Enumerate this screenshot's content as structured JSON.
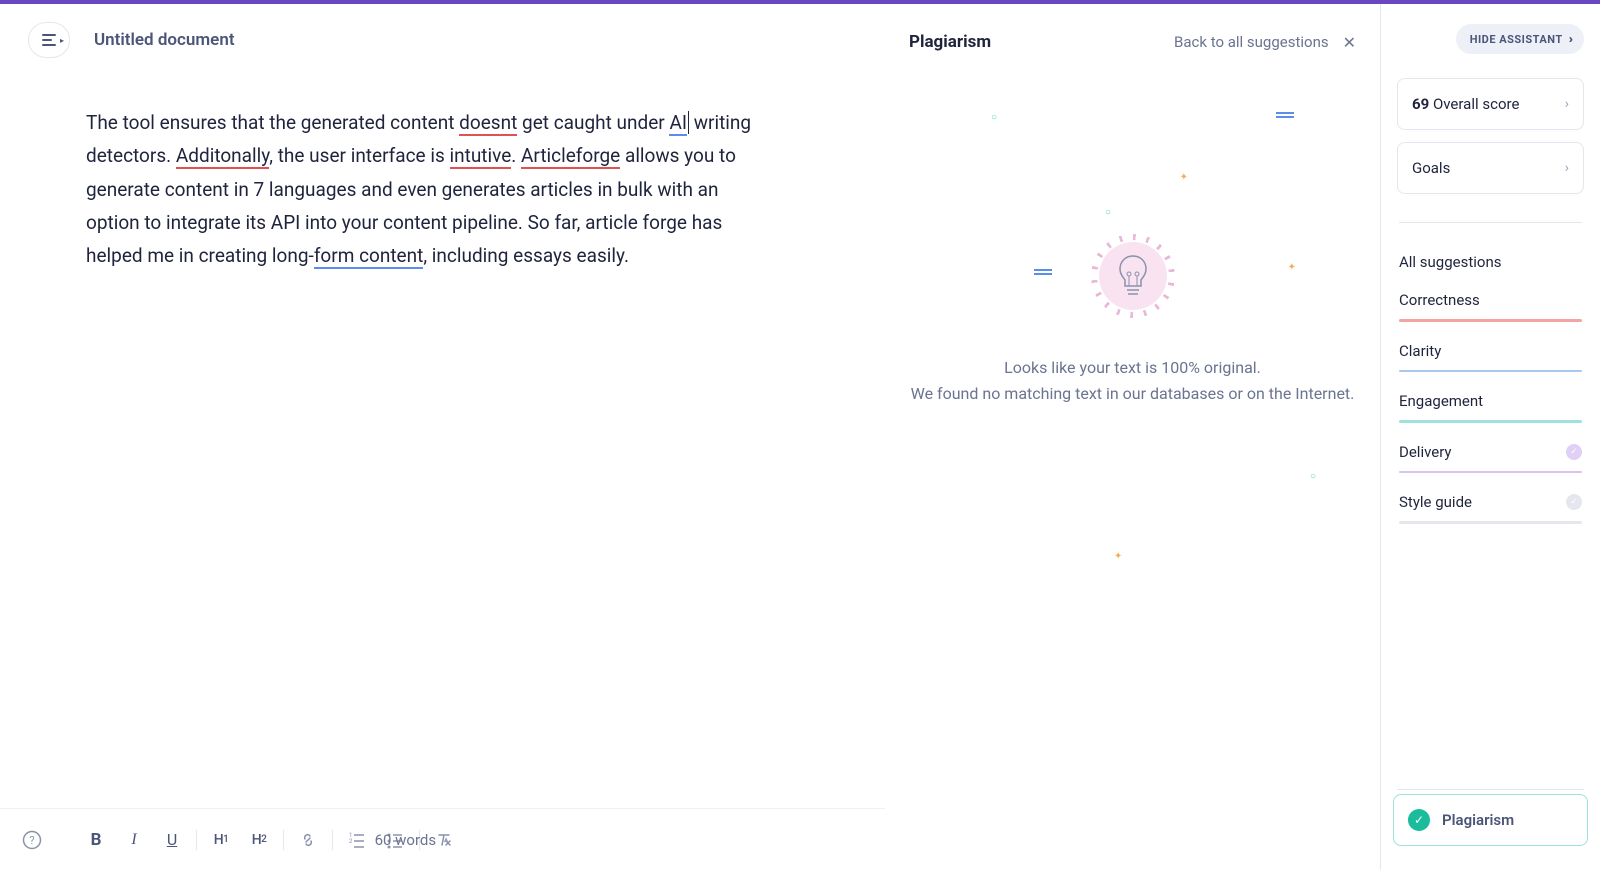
{
  "header": {
    "doc_title": "Untitled document"
  },
  "editor": {
    "t1": "The tool ensures that the generated content ",
    "w_doesnt": "doesnt",
    "t2": " get caught under ",
    "w_ai": "AI",
    "t3": " writing detectors. ",
    "w_additonally": "Additonally",
    "t4": ", the user interface is ",
    "w_intutive": "intutive",
    "t5": ". ",
    "w_articleforge": "Articleforge",
    "t6": " allows you to generate content in 7 languages and even generates articles in bulk with an option to integrate its API into your content pipeline. So far, article forge has helped me in creating long-",
    "w_form_content": "form content",
    "t7": ", including essays easily."
  },
  "toolbar": {
    "bold": "B",
    "italic": "I",
    "underline": "U",
    "h1": "H",
    "h1s": "1",
    "h2": "H",
    "h2s": "2",
    "word_count": "60 words"
  },
  "panel": {
    "title": "Plagiarism",
    "back": "Back to all suggestions",
    "empty_line1": "Looks like your text is 100% original.",
    "empty_line2": "We found no matching text in our databases or on the Internet."
  },
  "sidebar": {
    "hide": "HIDE ASSISTANT",
    "score_value": "69",
    "score_label": " Overall score",
    "goals": "Goals",
    "all_suggestions": "All suggestions",
    "categories": {
      "correctness": "Correctness",
      "clarity": "Clarity",
      "engagement": "Engagement",
      "delivery": "Delivery",
      "style_guide": "Style guide"
    },
    "plagiarism": "Plagiarism"
  }
}
